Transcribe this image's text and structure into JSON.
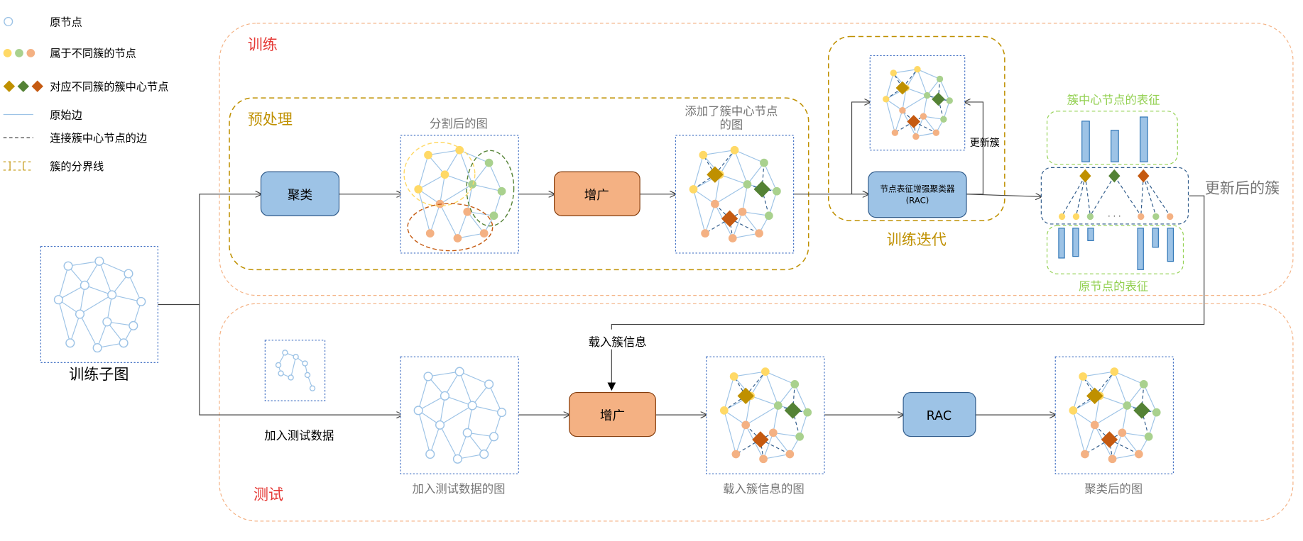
{
  "legend": {
    "original_node": "原节点",
    "cluster_nodes": "属于不同簇的节点",
    "cluster_centers": "对应不同簇的簇中心节点",
    "original_edge": "原始边",
    "center_edge": "连接簇中心节点的边",
    "cluster_boundary": "簇的分界线"
  },
  "sections": {
    "train": "训练",
    "preprocess": "预处理",
    "train_iter": "训练迭代",
    "test": "测试"
  },
  "nodes": {
    "cluster_box": "聚类",
    "augment_top": "增广",
    "rac_top_line1": "节点表征增强聚类器",
    "rac_top_line2": "(RAC)",
    "augment_bottom": "增广",
    "rac_bottom": "RAC"
  },
  "labels": {
    "split_graph": "分割后的图",
    "added_center_line1": "添加了簇中心节点",
    "added_center_line2": "的图",
    "update_cluster": "更新簇",
    "center_repr": "簇中心节点的表征",
    "node_repr": "原节点的表征",
    "updated_cluster": "更新后的簇",
    "train_subgraph": "训练子图",
    "load_cluster_info": "载入簇信息",
    "add_test_data": "加入测试数据",
    "graph_with_test": "加入测试数据的图",
    "graph_loaded": "载入簇信息的图",
    "graph_clustered": "聚类后的图",
    "ellipsis": "· · ·"
  },
  "colors": {
    "yellow": "#ffd966",
    "green": "#a9d18e",
    "salmon": "#f4b183",
    "gold_diamond": "#bf9000",
    "green_diamond": "#548235",
    "orange_diamond": "#c55a11",
    "blue_box": "#9dc3e6",
    "orange_box": "#f4b183",
    "train_border": "#f4b183",
    "preprocess_border": "#bf9000",
    "section_red": "#e53935",
    "section_gold": "#bf9000",
    "light_green": "#92d050"
  }
}
